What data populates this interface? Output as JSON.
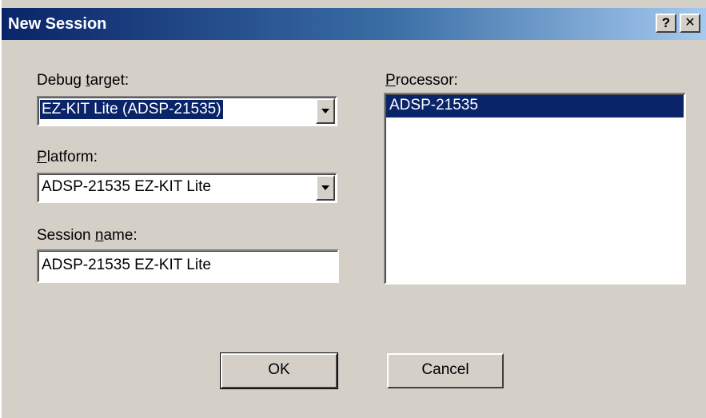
{
  "window": {
    "title": "New Session",
    "help_glyph": "?",
    "close_glyph": "✕"
  },
  "debug_target": {
    "label_prefix": "Debug ",
    "label_accel": "t",
    "label_suffix": "arget:",
    "value": "EZ-KIT Lite (ADSP-21535)"
  },
  "platform": {
    "label_prefix": "",
    "label_accel": "P",
    "label_suffix": "latform:",
    "value": "ADSP-21535 EZ-KIT Lite"
  },
  "session_name": {
    "label_prefix": "Session ",
    "label_accel": "n",
    "label_suffix": "ame:",
    "value": "ADSP-21535 EZ-KIT Lite"
  },
  "processor": {
    "label_prefix": "",
    "label_accel": "P",
    "label_suffix": "rocessor:",
    "items": [
      "ADSP-21535"
    ],
    "selected_index": 0
  },
  "buttons": {
    "ok": "OK",
    "cancel": "Cancel"
  },
  "colors": {
    "selection": "#0a246a",
    "face": "#d4d0c8"
  }
}
